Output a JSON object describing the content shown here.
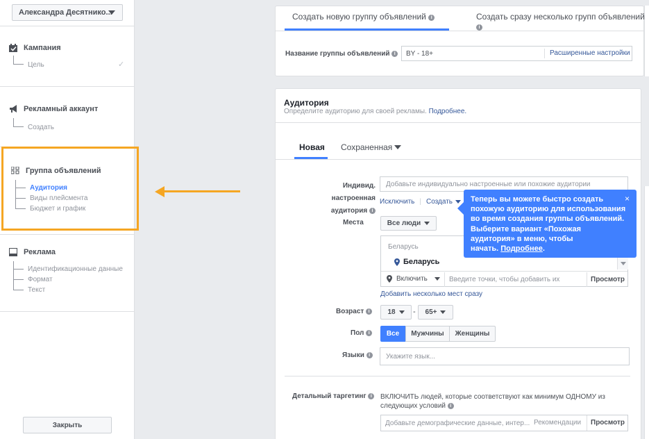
{
  "sidebar": {
    "account_name": "Александра Десятнико...",
    "sections": [
      {
        "title": "Кампания",
        "items": [
          "Цель"
        ]
      },
      {
        "title": "Рекламный аккаунт",
        "items": [
          "Создать"
        ]
      },
      {
        "title": "Группа объявлений",
        "items": [
          "Аудитория",
          "Виды плейсмента",
          "Бюджет и график"
        ]
      },
      {
        "title": "Реклама",
        "items": [
          "Идентификационные данные",
          "Формат",
          "Текст"
        ]
      }
    ],
    "check": "✓",
    "close_label": "Закрыть"
  },
  "top_tabs": {
    "tab1": "Создать новую группу объявлений",
    "tab2": "Создать сразу несколько групп объявлений"
  },
  "adset_name": {
    "label": "Название группы объявлений",
    "value": "BY - 18+",
    "advanced": "Расширенные настройки"
  },
  "audience": {
    "title": "Аудитория",
    "subtitle": "Определите аудиторию для своей рекламы.",
    "more": "Подробнее.",
    "tab_new": "Новая",
    "tab_saved": "Сохраненная",
    "custom_label_1": "Индивид. настроенная",
    "custom_label_2": "аудитория",
    "custom_placeholder": "Добавьте индивидуально настроенные или похожие аудитории",
    "exclude": "Исключить",
    "sep": "|",
    "create": "Создать",
    "places_label": "Места",
    "places_value": "Все люди",
    "location_group": "Беларусь",
    "location_item": "Беларусь",
    "include": "Включить",
    "location_placeholder": "Введите точки, чтобы добавить их",
    "browse": "Просмотр",
    "add_many": "Добавить несколько мест сразу",
    "age_label": "Возраст",
    "age_min": "18",
    "age_dash": "-",
    "age_max": "65+",
    "gender_label": "Пол",
    "gender_all": "Все",
    "gender_men": "Мужчины",
    "gender_women": "Женщины",
    "lang_label": "Языки",
    "lang_placeholder": "Укажите язык...",
    "detail_label": "Детальный таргетинг",
    "detail_text_1": "ВКЛЮЧИТЬ людей, которые соответствуют как минимум ОДНОМУ из",
    "detail_text_2": "следующих условий",
    "detail_placeholder": "Добавьте демографические данные, интер...",
    "recommendations": "Рекомендации",
    "detail_browse": "Просмотр"
  },
  "tooltip": {
    "line1": "Теперь вы можете быстро создать",
    "line2": "похожую аудиторию для использования",
    "line3": "во время создания группы объявлений.",
    "line4": "Выберите вариант «Похожая",
    "line5": "аудитория» в меню, чтобы",
    "line6": "начать.",
    "link": "Подробнее",
    "dot": ".",
    "close": "×"
  },
  "colors": {
    "accent": "#4080ff",
    "highlight": "#f5a623"
  }
}
